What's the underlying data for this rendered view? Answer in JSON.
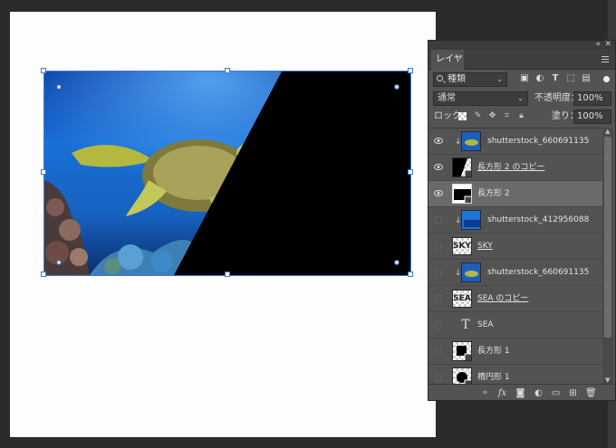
{
  "panel": {
    "tab_label": "レイヤー",
    "collapse_glyph": "«",
    "close_glyph": "✕",
    "filter": {
      "kind_label": "種類",
      "arrow": "⌄"
    },
    "filter_icons": [
      "image-icon",
      "adjustment-icon",
      "type-icon",
      "shape-icon",
      "smart-object-icon"
    ],
    "blend_mode": "通常",
    "opacity_label": "不透明度：",
    "opacity_value": "100%",
    "lock_label": "ロック：",
    "fill_label": "塗り：",
    "fill_value": "100%",
    "layers": [
      {
        "name": "shutterstock_660691135",
        "visible": true,
        "clipped": true,
        "thumb": "photo",
        "underline": false,
        "selected": false
      },
      {
        "name": "長方形 2 のコピー",
        "visible": true,
        "clipped": false,
        "thumb": "rect-copy",
        "underline": true,
        "selected": false
      },
      {
        "name": "長方形 2",
        "visible": true,
        "clipped": false,
        "thumb": "rect",
        "underline": false,
        "selected": true
      },
      {
        "name": "shutterstock_412956088",
        "visible": false,
        "clipped": true,
        "thumb": "photo",
        "underline": false,
        "selected": false
      },
      {
        "name": "SKY",
        "visible": false,
        "clipped": false,
        "thumb": "text-sky",
        "underline": true,
        "selected": false
      },
      {
        "name": "shutterstock_660691135",
        "visible": false,
        "clipped": true,
        "thumb": "photo",
        "underline": false,
        "selected": false
      },
      {
        "name": "SEA のコピー",
        "visible": false,
        "clipped": false,
        "thumb": "text-sea",
        "underline": true,
        "selected": false
      },
      {
        "name": "SEA",
        "visible": false,
        "clipped": false,
        "thumb": "type",
        "underline": false,
        "selected": false
      },
      {
        "name": "長方形 1",
        "visible": false,
        "clipped": false,
        "thumb": "rect-small",
        "underline": false,
        "selected": false
      },
      {
        "name": "楕円形 1",
        "visible": false,
        "clipped": false,
        "thumb": "ellipse",
        "underline": false,
        "selected": false
      }
    ],
    "thumb_text": {
      "sky": "SKY",
      "sea": "SEA",
      "type_glyph": "T"
    },
    "bottom_icons": [
      "link-icon",
      "fx-icon",
      "mask-icon",
      "adjustment-layer-icon",
      "group-folder-icon",
      "new-layer-icon",
      "trash-icon"
    ],
    "bottom_fx_label": "fx"
  }
}
